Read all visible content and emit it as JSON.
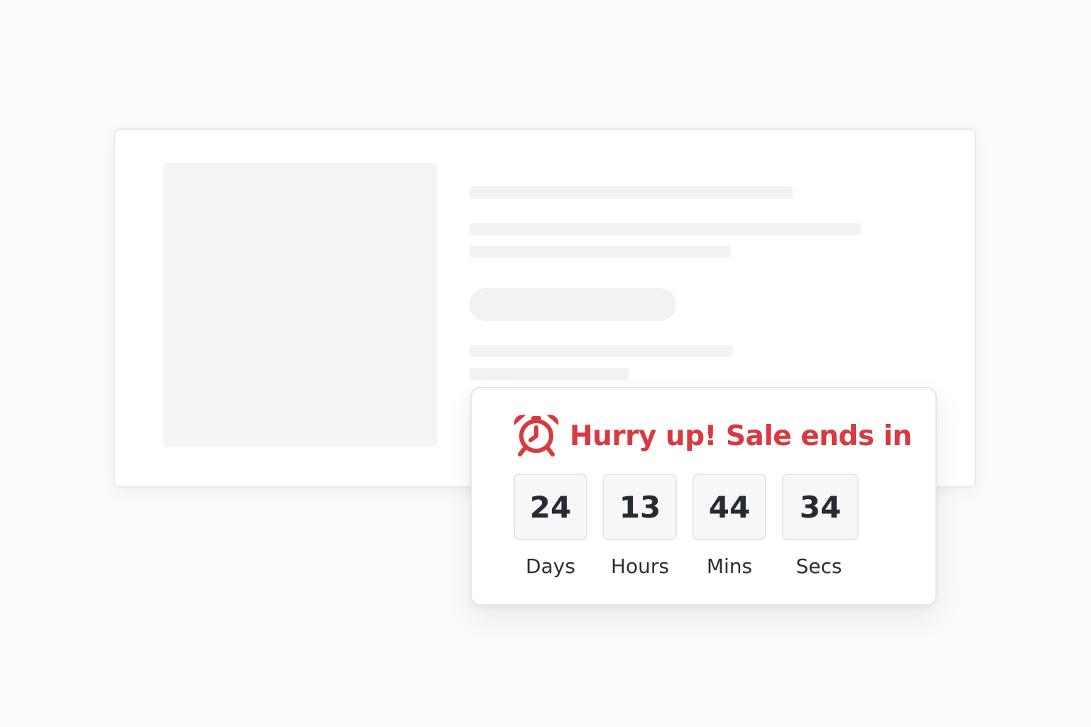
{
  "banner": {
    "headline": "Hurry up! Sale ends in",
    "accent_color": "#d93a3f",
    "icon": "alarm-clock-icon"
  },
  "countdown": [
    {
      "value": "24",
      "label": "Days"
    },
    {
      "value": "13",
      "label": "Hours"
    },
    {
      "value": "44",
      "label": "Mins"
    },
    {
      "value": "34",
      "label": "Secs"
    }
  ]
}
